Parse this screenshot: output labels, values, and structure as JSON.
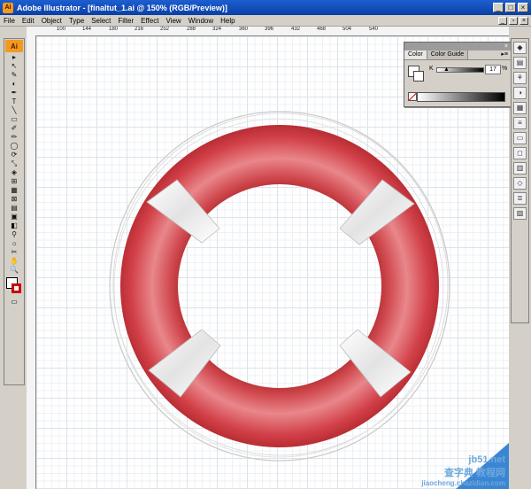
{
  "app": {
    "title": "Adobe Illustrator - [finaltut_1.ai @ 150% (RGB/Preview)]",
    "icon_text": "Ai"
  },
  "menus": [
    "File",
    "Edit",
    "Object",
    "Type",
    "Select",
    "Filter",
    "Effect",
    "View",
    "Window",
    "Help"
  ],
  "ruler": {
    "top_labels": [
      "100",
      "144",
      "180",
      "216",
      "252",
      "288",
      "324",
      "360",
      "396",
      "432",
      "468",
      "504",
      "540"
    ]
  },
  "tools": [
    "▸",
    "↖",
    "✎",
    "◐",
    "✒",
    "T",
    "╲",
    "▭",
    "✐",
    "✏",
    "◯",
    "⟳",
    "⤡",
    "◈",
    "⊞",
    "▦",
    "⊠",
    "▤",
    "▣",
    "◧",
    "⚲",
    "☼",
    "✂",
    "✋",
    "🔍"
  ],
  "color_panel": {
    "tabs": [
      "Color",
      "Color Guide"
    ],
    "channel": "K",
    "value": "17",
    "unit": "%",
    "close": "×",
    "menu": "▸≡"
  },
  "dock_icons": [
    "◆",
    "▤",
    "⚘",
    "◑",
    "▦",
    "≡",
    "▭",
    "◻",
    "▥",
    "◇",
    "≣",
    "▨"
  ],
  "watermark": {
    "line1": "jb51.net",
    "line2": "查字典 教程网",
    "line3": "jiaocheng.chazidian.com"
  },
  "colors": {
    "buoy_red": "#c8363b",
    "strap": "#f1f1f1",
    "title_bar": "#0a3fa5",
    "accent": "#f39a1e"
  }
}
